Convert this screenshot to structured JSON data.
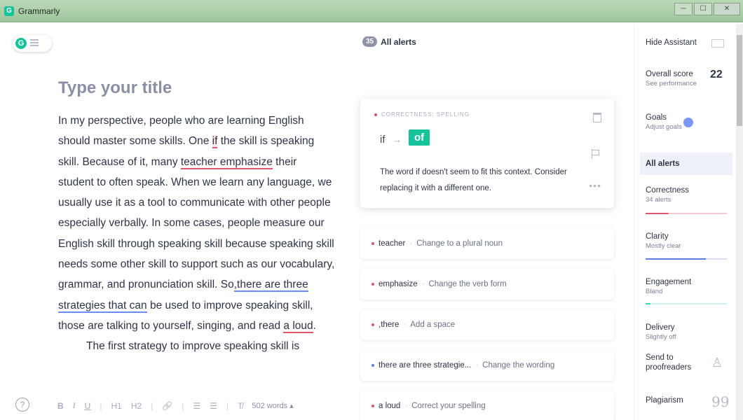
{
  "window": {
    "title": "Grammarly",
    "app_icon": "G",
    "min": "─",
    "max": "☐",
    "close": "✕"
  },
  "editor": {
    "logo": "G",
    "title_placeholder": "Type your title",
    "p1": {
      "t1": "In my perspective, people who are learning English should master some skills. One ",
      "e1": "if",
      "t2": " the skill is speaking skill. Because of it, many ",
      "e2": "teacher emphasize",
      "t3": " their student to often speak. When we learn any language, we usually use it as a tool to communicate with other people especially verbally. In some cases, people measure our English skill through speaking skill because speaking skill needs some other skill to support such as our vocabulary, grammar, and pronunciation skill. So",
      "e3": ",there are three strategies that can",
      "t4": " be used to improve speaking skill, those are talking to yourself, singing, and read ",
      "e4": "a loud",
      "t5": "."
    },
    "p2": "The first strategy to improve speaking skill is",
    "toolbar": {
      "bold": "B",
      "italic": "I",
      "underline": "U",
      "h1": "H1",
      "h2": "H2",
      "link": "🔗",
      "ol": "☰",
      "ul": "☰",
      "clear": "T̸",
      "word_count": "502 words ▴"
    },
    "help": "?"
  },
  "alerts": {
    "count": "35",
    "title": "All alerts",
    "expanded": {
      "category": "CORRECTNESS: SPELLING",
      "original": "if",
      "arrow": "→",
      "replacement": "of",
      "explanation": "The word if doesn't seem to fit this context. Consider replacing it with a different one.",
      "more": "•••"
    },
    "items": [
      {
        "word": "teacher",
        "desc": "Change to a plural noun"
      },
      {
        "word": "emphasize",
        "desc": "Change the verb form"
      },
      {
        "word": ",there",
        "desc": "Add a space"
      },
      {
        "word": "there are three strategie...",
        "desc": "Change the wording"
      },
      {
        "word": "a loud",
        "desc": "Correct your spelling"
      }
    ],
    "separator": "·"
  },
  "sidebar": {
    "hide": "Hide Assistant",
    "overall": "Overall score",
    "score": "22",
    "see_perf": "See performance",
    "goals": "Goals",
    "adjust": "Adjust goals",
    "all_alerts": "All alerts",
    "correctness": "Correctness",
    "correctness_sub": "34 alerts",
    "clarity": "Clarity",
    "clarity_sub": "Mostly clear",
    "engagement": "Engagement",
    "engagement_sub": "Bland",
    "delivery": "Delivery",
    "delivery_sub": "Slightly off",
    "send": "Send to proofreaders",
    "plagiarism": "Plagiarism",
    "proof_icon": "♙",
    "plag_icon": "99"
  },
  "colors": {
    "accent": "#15c39a",
    "correctness": "#e0556b",
    "clarity": "#5b7cf5",
    "engagement": "#3fd7b4",
    "delivery": "#8b5cf6"
  }
}
